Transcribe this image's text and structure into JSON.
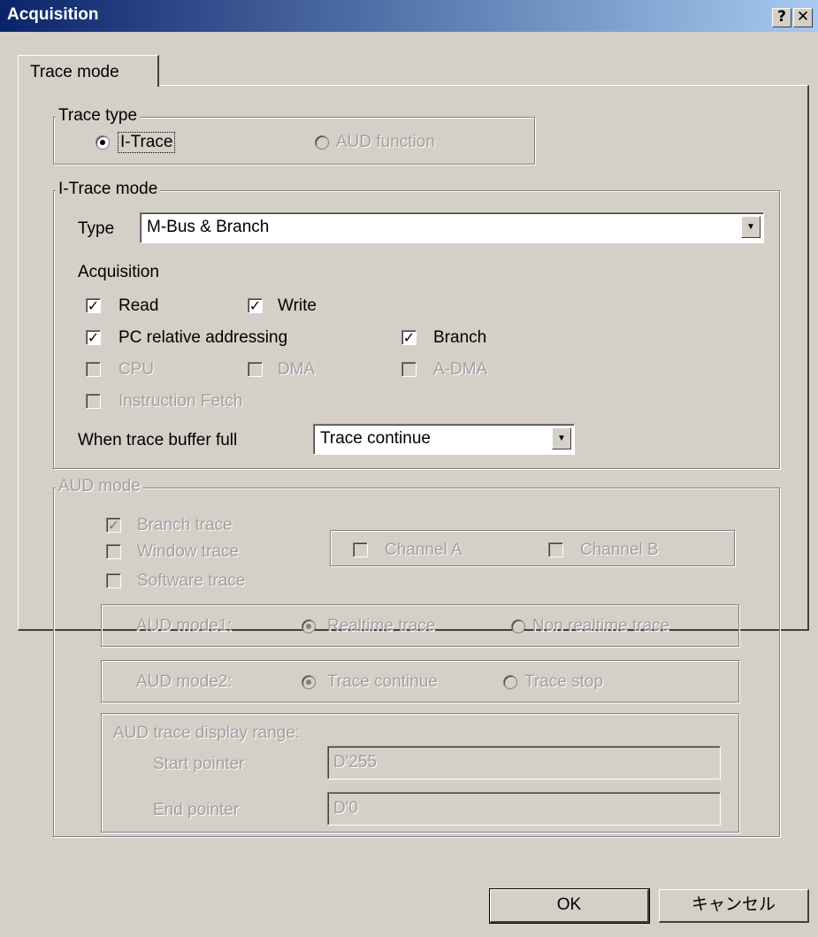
{
  "window": {
    "title": "Acquisition",
    "help_label": "?",
    "close_label": "✕"
  },
  "tabs": [
    {
      "label": "Trace mode",
      "active": true
    }
  ],
  "trace_type": {
    "legend": "Trace type",
    "options": [
      {
        "label": "I-Trace",
        "selected": true,
        "enabled": true
      },
      {
        "label": "AUD function",
        "selected": false,
        "enabled": false
      }
    ]
  },
  "itrace_mode": {
    "legend": "I-Trace mode",
    "type_label": "Type",
    "type_value": "M-Bus & Branch",
    "acquisition_label": "Acquisition",
    "checkboxes": [
      {
        "label": "Read",
        "checked": true,
        "enabled": true
      },
      {
        "label": "Write",
        "checked": true,
        "enabled": true
      },
      {
        "label": "PC relative addressing",
        "checked": true,
        "enabled": true
      },
      {
        "label": "Branch",
        "checked": true,
        "enabled": true
      },
      {
        "label": "CPU",
        "checked": false,
        "enabled": false
      },
      {
        "label": "DMA",
        "checked": false,
        "enabled": false
      },
      {
        "label": "A-DMA",
        "checked": false,
        "enabled": false
      },
      {
        "label": "Instruction Fetch",
        "checked": false,
        "enabled": false
      }
    ],
    "buffer_full_label": "When trace buffer full",
    "buffer_full_value": "Trace continue"
  },
  "aud_mode": {
    "legend": "AUD mode",
    "checkboxes": [
      {
        "label": "Branch trace",
        "checked": true,
        "enabled": false
      },
      {
        "label": "Window trace",
        "checked": false,
        "enabled": false
      },
      {
        "label": "Software trace",
        "checked": false,
        "enabled": false
      }
    ],
    "channels": [
      {
        "label": "Channel A",
        "checked": false
      },
      {
        "label": "Channel B",
        "checked": false
      }
    ],
    "mode1": {
      "label": "AUD mode1:",
      "options": [
        {
          "label": "Realtime trace",
          "selected": true
        },
        {
          "label": "Non realtime trace",
          "selected": false
        }
      ]
    },
    "mode2": {
      "label": "AUD mode2:",
      "options": [
        {
          "label": "Trace continue",
          "selected": true
        },
        {
          "label": "Trace stop",
          "selected": false
        }
      ]
    },
    "display_range": {
      "label": "AUD trace display range:",
      "start_label": "Start pointer",
      "start_value": "D'255",
      "end_label": "End pointer",
      "end_value": "D'0"
    }
  },
  "buttons": {
    "ok": "OK",
    "cancel": "キャンセル"
  }
}
